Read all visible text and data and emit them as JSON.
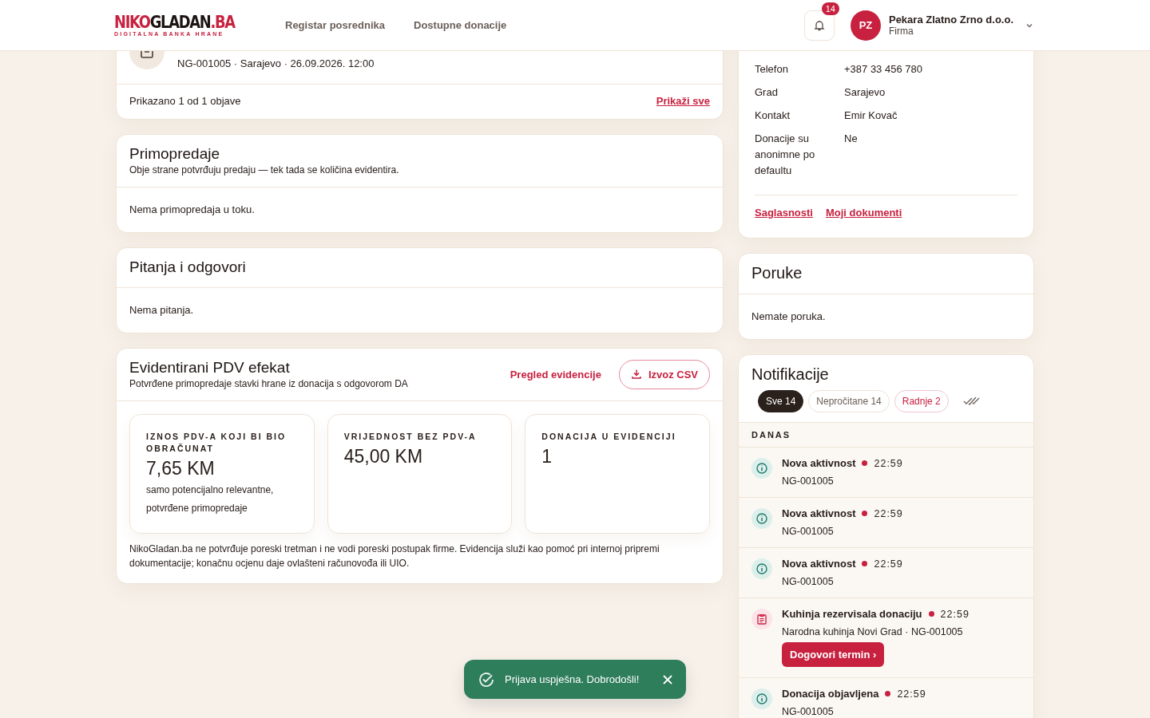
{
  "header": {
    "logo_main": "NIKO",
    "logo_mid": "GLADAN",
    "logo_tld": ".BA",
    "logo_tagline": "DIGITALNA BANKA HRANE",
    "nav": [
      "Registar posrednika",
      "Dostupne donacije"
    ],
    "notifications_badge": "14",
    "user": {
      "initials": "PZ",
      "name": "Pekara Zlatno Zrno d.o.o.",
      "role": "Firma"
    }
  },
  "listing_card": {
    "meta": "NG-001005 · Sarajevo · 26.09.2026. 12:00",
    "summary": "Prikazano 1 od 1 objave",
    "link": "Prikaži sve"
  },
  "handovers": {
    "title": "Primopredaje",
    "subtitle": "Obje strane potvrđuju predaju — tek tada se količina evidentira.",
    "empty": "Nema primopredaja u toku."
  },
  "qa": {
    "title": "Pitanja i odgovori",
    "empty": "Nema pitanja."
  },
  "vat": {
    "title": "Evidentirani PDV efekat",
    "subtitle": "Potvrđene primopredaje stavki hrane iz donacija s odgovorom DA",
    "link": "Pregled evidencije",
    "export_button": "Izvoz CSV",
    "stats": [
      {
        "label": "IZNOS PDV-A KOJI BI BIO OBRAČUNAT",
        "value": "7,65 KM",
        "note": "samo potencijalno relevantne, potvrđene primopredaje"
      },
      {
        "label": "VRIJEDNOST BEZ PDV-A",
        "value": "45,00 KM"
      },
      {
        "label": "DONACIJA U EVIDENCIJI",
        "value": "1"
      }
    ],
    "disclaimer": "NikoGladan.ba ne potvrđuje poreski tretman i ne vodi poreski postupak firme. Evidencija služi kao pomoć pri internoj pripremi dokumentacije; konačnu ocjenu daje ovlašteni računovođa ili UIO."
  },
  "profile": {
    "fields": [
      {
        "label": "Telefon",
        "value": "+387 33 456 780"
      },
      {
        "label": "Grad",
        "value": "Sarajevo"
      },
      {
        "label": "Kontakt",
        "value": "Emir Kovač"
      },
      {
        "label": "Donacije su anonimne po defaultu",
        "value": "Ne"
      }
    ],
    "links": [
      "Saglasnosti",
      "Moji dokumenti"
    ]
  },
  "messages": {
    "title": "Poruke",
    "empty": "Nemate poruka."
  },
  "notifications": {
    "title": "Notifikacije",
    "filters": [
      {
        "label": "Sve 14",
        "selected": true,
        "kind": "plain"
      },
      {
        "label": "Nepročitane 14",
        "selected": false,
        "kind": "plain"
      },
      {
        "label": "Radnje 2",
        "selected": false,
        "kind": "action"
      }
    ],
    "group": "DANAS",
    "items": [
      {
        "kind": "info",
        "title": "Nova aktivnost",
        "unread": true,
        "time": "22:59",
        "detail": "NG-001005"
      },
      {
        "kind": "info",
        "title": "Nova aktivnost",
        "unread": true,
        "time": "22:59",
        "detail": "NG-001005"
      },
      {
        "kind": "info",
        "title": "Nova aktivnost",
        "unread": true,
        "time": "22:59",
        "detail": "NG-001005"
      },
      {
        "kind": "task",
        "title": "Kuhinja rezervisala donaciju",
        "unread": true,
        "time": "22:59",
        "detail": "Narodna kuhinja Novi Grad · NG-001005",
        "action": "Dogovori termin ›"
      },
      {
        "kind": "info",
        "title": "Donacija objavljena",
        "unread": true,
        "time": "22:59",
        "detail": "NG-001005"
      }
    ]
  },
  "toast": {
    "text": "Prijava uspješna. Dobrodošli!"
  }
}
